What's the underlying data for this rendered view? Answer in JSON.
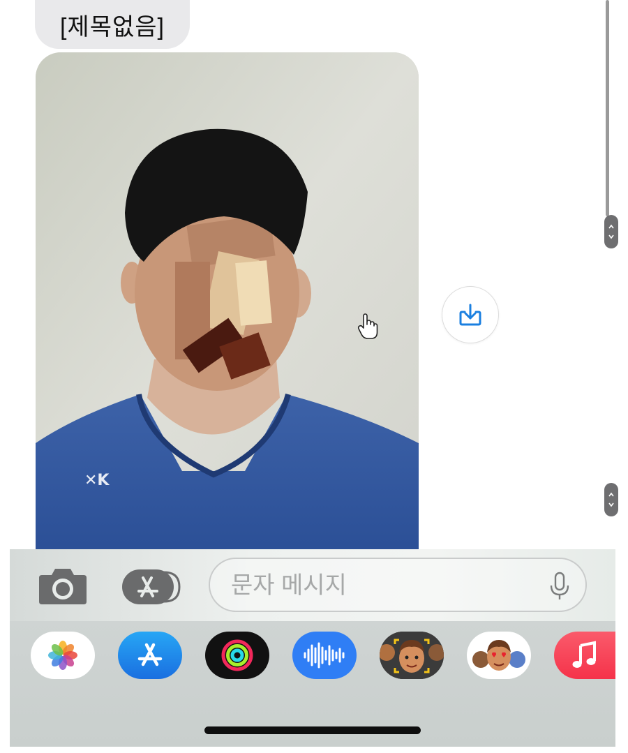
{
  "message": {
    "subject": "[제목없음]",
    "attachment_icon": "photo-attachment"
  },
  "actions": {
    "save_icon": "download-icon"
  },
  "composer": {
    "placeholder": "문자 메시지",
    "value": "",
    "camera_icon": "camera-icon",
    "apps_icon": "app-store-icon",
    "mic_icon": "microphone-icon"
  },
  "app_drawer": {
    "apps": [
      {
        "id": "photos",
        "icon": "photos-icon"
      },
      {
        "id": "app-store",
        "icon": "app-store-icon"
      },
      {
        "id": "activity",
        "icon": "activity-rings-icon"
      },
      {
        "id": "audio",
        "icon": "audio-waveform-icon"
      },
      {
        "id": "memoji",
        "icon": "memoji-icon"
      },
      {
        "id": "memoji-stickers",
        "icon": "memoji-stickers-icon"
      },
      {
        "id": "music",
        "icon": "music-note-icon"
      }
    ]
  },
  "colors": {
    "accent_blue": "#1a7fe0",
    "bubble_gray": "#e9e9eb",
    "music_red": "#f5334a"
  }
}
